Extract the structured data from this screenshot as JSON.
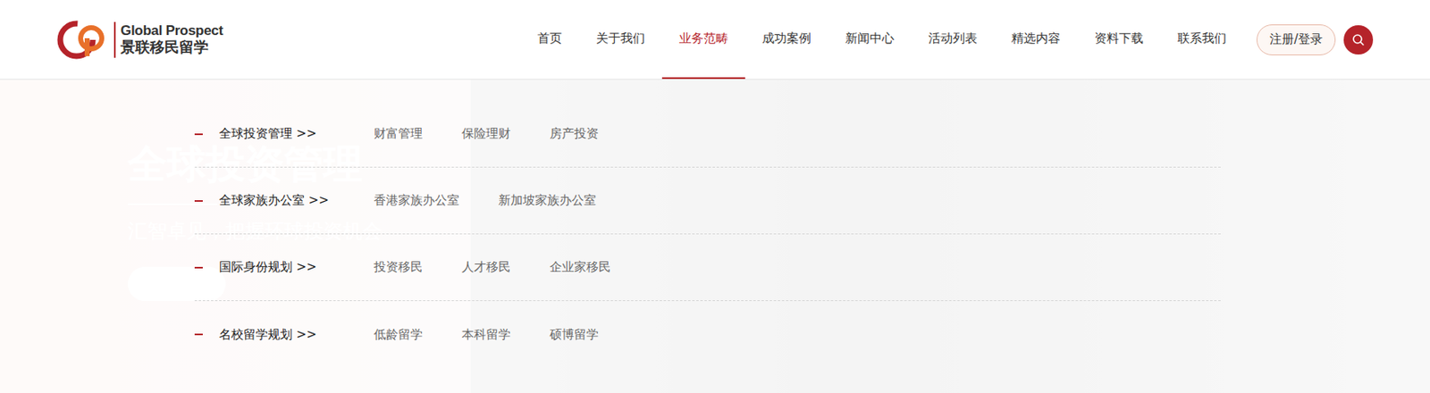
{
  "logo": {
    "en": "Global Prospect",
    "cn": "景联移民留学"
  },
  "nav": [
    {
      "label": "首页",
      "selected": false
    },
    {
      "label": "关于我们",
      "selected": false
    },
    {
      "label": "业务范畴",
      "selected": true
    },
    {
      "label": "成功案例",
      "selected": false
    },
    {
      "label": "新闻中心",
      "selected": false
    },
    {
      "label": "活动列表",
      "selected": false
    },
    {
      "label": "精选内容",
      "selected": false
    },
    {
      "label": "资料下载",
      "selected": false
    },
    {
      "label": "联系我们",
      "selected": false
    }
  ],
  "auth_button": "注册/登录",
  "hero": {
    "title": "全球投资管理",
    "subtitle": "汇智卓见，把握环球投资机会"
  },
  "menu": [
    {
      "title": "全球投资管理 >>",
      "items": [
        "财富管理",
        "保险理财",
        "房产投资"
      ]
    },
    {
      "title": "全球家族办公室 >>",
      "items": [
        "香港家族办公室",
        "新加坡家族办公室"
      ]
    },
    {
      "title": "国际身份规划 >>",
      "items": [
        "投资移民",
        "人才移民",
        "企业家移民"
      ]
    },
    {
      "title": "名校留学规划 >>",
      "items": [
        "低龄留学",
        "本科留学",
        "硕博留学"
      ]
    }
  ]
}
